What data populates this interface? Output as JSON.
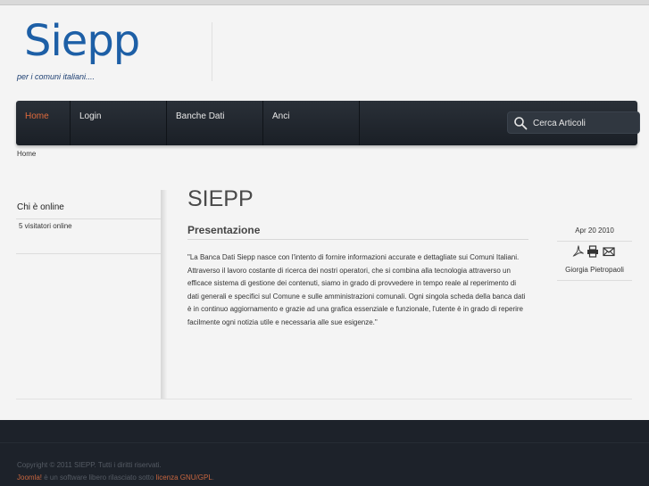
{
  "header": {
    "logo_text": "Siepp",
    "tagline": "per i comuni italiani...."
  },
  "nav": {
    "items": [
      {
        "label": "Home",
        "active": true
      },
      {
        "label": "Login",
        "active": false
      },
      {
        "label": "Banche Dati",
        "active": false
      },
      {
        "label": "Anci",
        "active": false
      }
    ],
    "search_placeholder": "Cerca Articoli"
  },
  "breadcrumb": "Home",
  "sidebar": {
    "module_title": "Chi è online",
    "visitors_text": "5 visitatori online"
  },
  "article": {
    "page_title": "SIEPP",
    "title": "Presentazione",
    "body": "\"La Banca Dati Siepp nasce con l'intento di fornire informazioni accurate e dettagliate sui Comuni Italiani. Attraverso il lavoro costante di ricerca dei nostri operatori, che si combina alla tecnologia attraverso un efficace sistema di gestione dei contenuti, siamo in grado di provvedere in tempo reale al reperimento di dati generali e specifici sul Comune e sulle amministrazioni comunali. Ogni singola scheda della banca dati è in continuo aggiornamento e grazie ad una grafica essenziale e funzionale, l'utente è in grado di reperire facilmente ogni notizia utile e necessaria alle sue esigenze.\"",
    "date": "Apr 20 2010",
    "author": "Giorgia Pietropaoli",
    "icons": [
      "pdf-icon",
      "print-icon",
      "email-icon"
    ]
  },
  "footer": {
    "copyright": "Copyright © 2011 SIEPP. Tutti i diritti riservati.",
    "joomla_link": "Joomla!",
    "license_text": " è un software libero rilasciato sotto ",
    "license_link": "licenza GNU/GPL",
    "license_end": "."
  },
  "colors": {
    "accent": "#e06a3c",
    "logo": "#1d5fa6",
    "navbar": "#1f252d",
    "footer": "#1d222a"
  }
}
